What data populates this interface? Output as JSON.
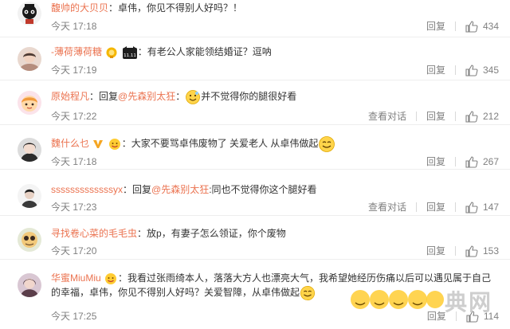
{
  "actions": {
    "reply_label": "回复",
    "view_conversation_label": "查看对话"
  },
  "comments": [
    {
      "username": "馥帅的大贝贝",
      "content": "：卓伟，你见不得别人好吗？！",
      "time": "今天 17:18",
      "likes": "434",
      "avatar_icon": "cartoon-avatar-icon"
    },
    {
      "username": "-薄荷薄荷糖",
      "content": "：有老公人家能领结婚证？逗呐",
      "time": "今天 17:19",
      "likes": "345",
      "badge_icons": [
        "gold-badge-icon",
        "cat-1111-badge-icon"
      ],
      "badge_text": "11.11"
    },
    {
      "username": "原始程凡",
      "reply_word": "：回复",
      "mention": "@先森别太狂",
      "content": "：",
      "emoji": "smile-emoji-icon",
      "content_after": "并不觉得你的腿很好看",
      "time": "今天 17:22",
      "likes": "212",
      "has_view_conversation": true
    },
    {
      "username": "魏什么乜",
      "content": "：大家不要骂卓伟废物了 关爱老人 从卓伟做起",
      "time": "今天 17:18",
      "likes": "267",
      "badge_icons": [
        "vip-v-icon",
        "emoji-badge-icon"
      ],
      "emoji": "grin-emoji-icon"
    },
    {
      "username": "sssssssssssssyx",
      "reply_word": "：回复",
      "mention": "@先森别太狂",
      "content": ":同也不觉得你这个腿好看",
      "time": "今天 17:23",
      "likes": "147",
      "has_view_conversation": true
    },
    {
      "username": "寻找卷心菜的毛毛虫",
      "content": "：放p，有妻子怎么领证，你个废物",
      "time": "今天 17:20",
      "likes": "153"
    },
    {
      "username": "华蜜MiuMiu",
      "content": "：我看过张雨绮本人，落落大方人也漂亮大气，我希望她经历伤痛以后可以遇见属于自己的幸福，卓伟，你见不得别人好吗？关爱智障，从卓伟做起",
      "time": "今天 17:25",
      "likes": "114",
      "badge_icons": [
        "emoji-badge-icon"
      ],
      "emoji": "grin-emoji-icon"
    }
  ],
  "watermark": {
    "text": "典网"
  },
  "colors": {
    "username": "#eb7350",
    "text": "#333333",
    "meta": "#808080"
  }
}
